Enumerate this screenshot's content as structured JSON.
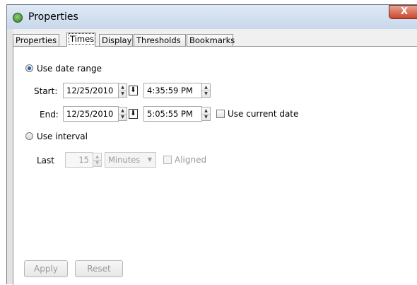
{
  "window": {
    "title": "Properties",
    "close_label": "X"
  },
  "tabs": [
    {
      "label": "Properties",
      "active": false
    },
    {
      "label": "Times",
      "active": true
    },
    {
      "label": "Display",
      "active": false
    },
    {
      "label": "Thresholds",
      "active": false
    },
    {
      "label": "Bookmarks",
      "active": false
    }
  ],
  "date_range": {
    "radio_label": "Use date range",
    "selected": true,
    "start": {
      "label": "Start:",
      "date": "12/25/2010",
      "time": "4:35:59 PM"
    },
    "end": {
      "label": "End:",
      "date": "12/25/2010",
      "time": "5:05:55 PM"
    },
    "use_current_date_label": "Use current date",
    "use_current_date_checked": false
  },
  "interval": {
    "radio_label": "Use interval",
    "selected": false,
    "last_label": "Last",
    "value": "15",
    "unit": "Minutes",
    "aligned_label": "Aligned",
    "aligned_checked": false
  },
  "buttons": {
    "apply_label": "Apply",
    "reset_label": "Reset"
  },
  "icons": {
    "calendar": "calendar-download-icon",
    "spin_up": "▲",
    "spin_down": "▼",
    "dropdown": "▼"
  }
}
